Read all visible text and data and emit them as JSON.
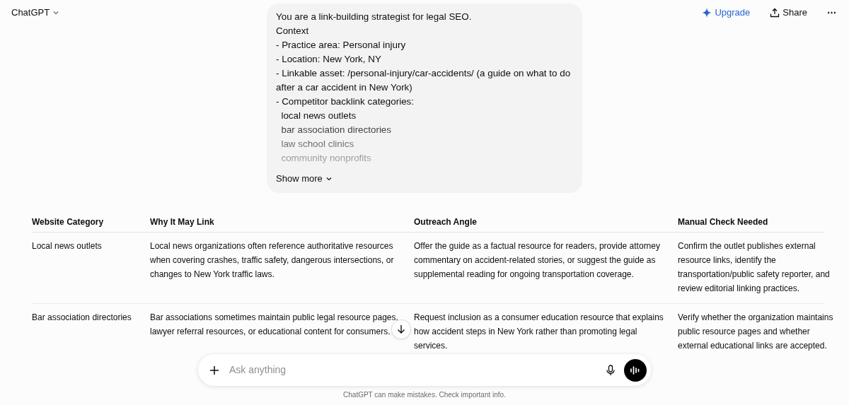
{
  "header": {
    "title": "ChatGPT",
    "actions": [
      {
        "kind": "upgrade",
        "label": "Upgrade"
      },
      {
        "kind": "share",
        "label": "Share"
      },
      {
        "kind": "more",
        "label": "⋯"
      }
    ]
  },
  "prompt": {
    "lines": [
      "You are a link-building strategist for legal SEO.",
      "Context",
      "- Practice area: Personal injury",
      "- Location: New York, NY",
      "- Linkable asset: /personal-injury/car-accidents/ (a guide on what to do after a car accident in New York)",
      "- Competitor backlink categories:",
      "  local news outlets",
      "  bar association directories",
      "  law school clinics",
      "  community nonprofits"
    ],
    "show_more": "Show more"
  },
  "table": {
    "columns": [
      "Website Category",
      "Why It May Link",
      "Outreach Angle",
      "Manual Check Needed"
    ],
    "rows": [
      [
        "Local news outlets",
        "Local news organizations often reference authoritative resources when covering crashes, traffic safety, dangerous intersections, or changes to New York traffic laws.",
        "Offer the guide as a factual resource for readers, provide attorney commentary on accident-related stories, or suggest the guide as supplemental reading for ongoing transportation coverage.",
        "Confirm the outlet publishes external resource links, identify the transportation/public safety reporter, and review editorial linking practices."
      ],
      [
        "Bar association directories",
        "Bar associations sometimes maintain public legal resource pages, lawyer referral resources, or educational content for consumers.",
        "Request inclusion as a consumer education resource that explains how accident steps in New York rather than promoting legal services.",
        "Verify whether the organization maintains public resource pages and whether external educational links are accepted."
      ]
    ]
  },
  "composer": {
    "placeholder": "Ask anything"
  },
  "disclaimer": "ChatGPT can make mistakes. Check important info."
}
